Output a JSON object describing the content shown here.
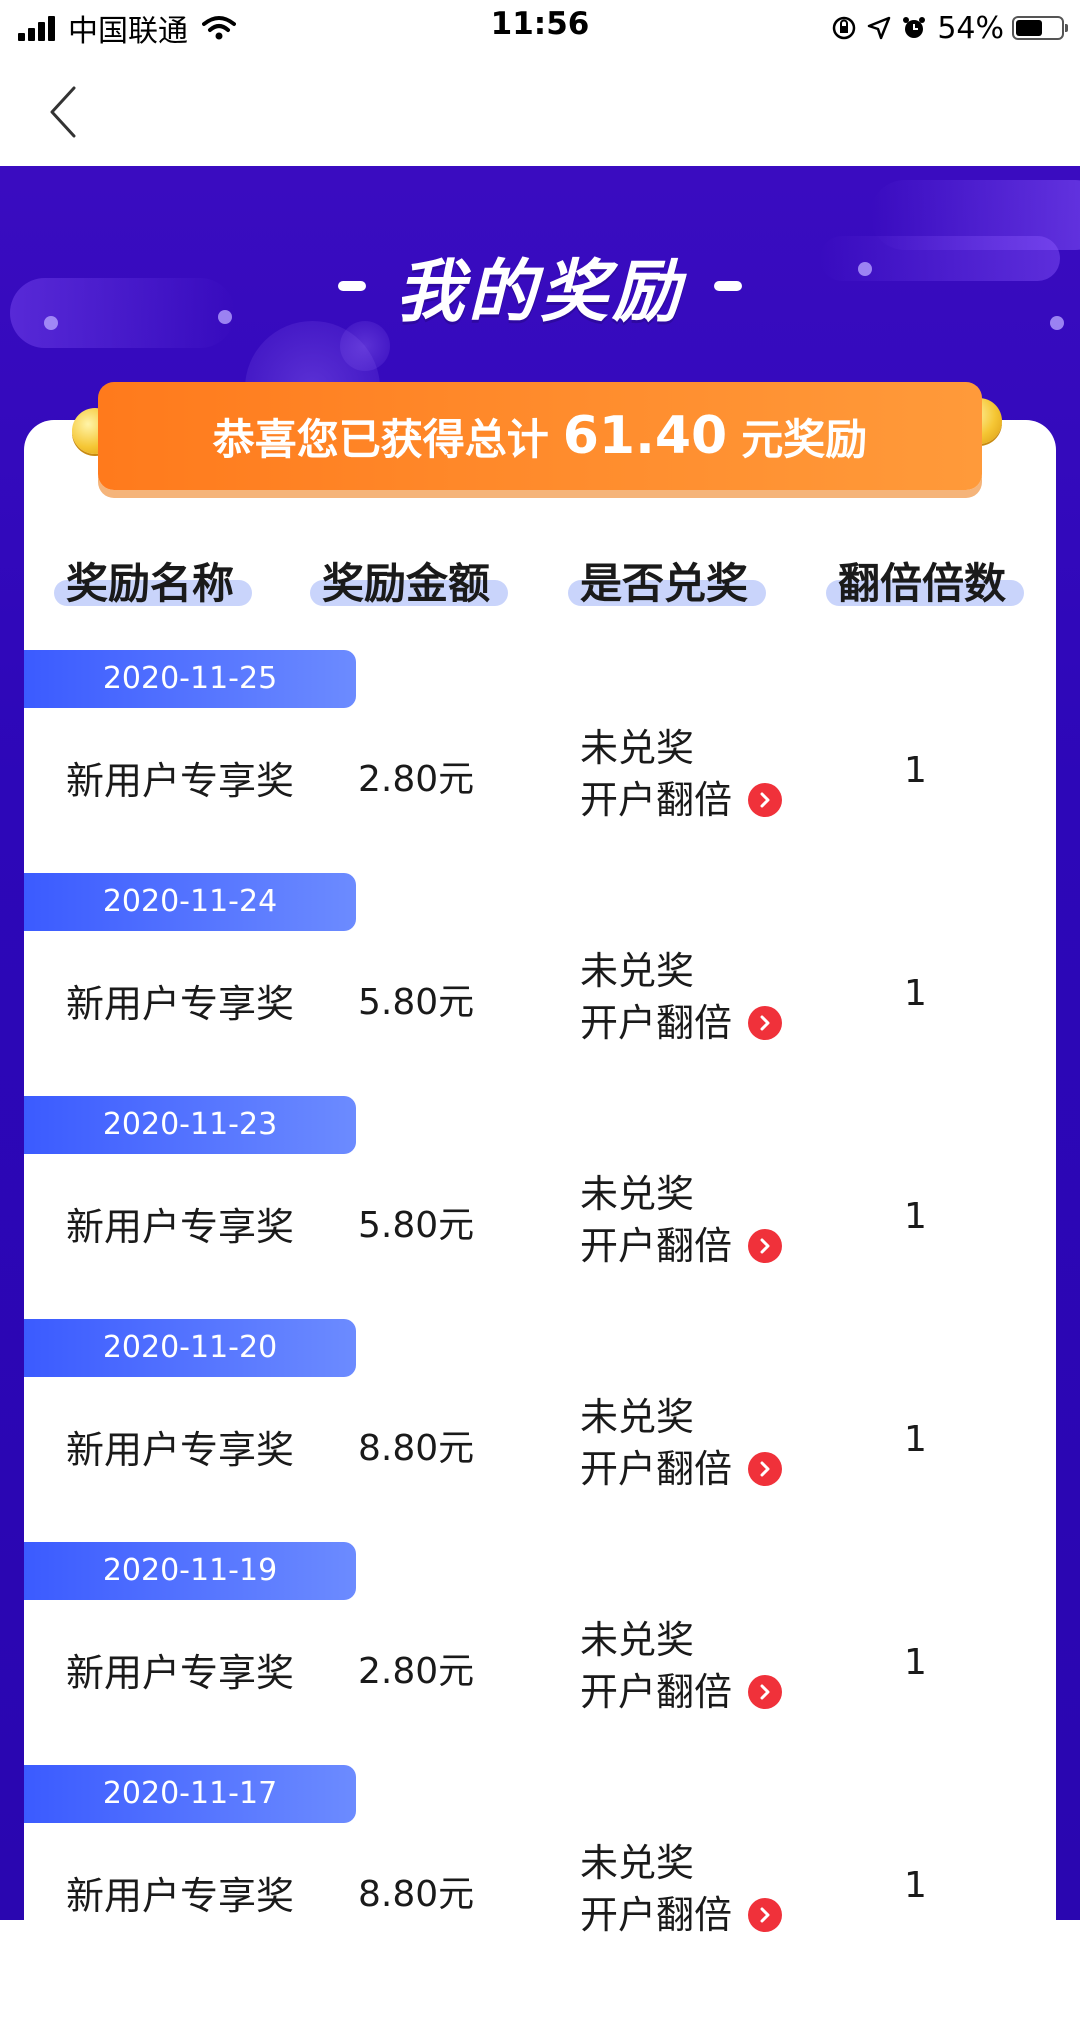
{
  "status_bar": {
    "carrier": "中国联通",
    "time": "11:56",
    "battery": "54%"
  },
  "page": {
    "title": "我的奖励",
    "banner": {
      "prefix": "恭喜您已获得总计",
      "amount": "61.40",
      "suffix": "元奖励"
    },
    "columns": [
      "奖励名称",
      "奖励金额",
      "是否兑奖",
      "翻倍倍数"
    ]
  },
  "records": [
    {
      "date": "2020-11-25",
      "name": "新用户专享奖",
      "amount": "2.80元",
      "status": "未兑奖",
      "action": "开户翻倍",
      "multiplier": "1"
    },
    {
      "date": "2020-11-24",
      "name": "新用户专享奖",
      "amount": "5.80元",
      "status": "未兑奖",
      "action": "开户翻倍",
      "multiplier": "1"
    },
    {
      "date": "2020-11-23",
      "name": "新用户专享奖",
      "amount": "5.80元",
      "status": "未兑奖",
      "action": "开户翻倍",
      "multiplier": "1"
    },
    {
      "date": "2020-11-20",
      "name": "新用户专享奖",
      "amount": "8.80元",
      "status": "未兑奖",
      "action": "开户翻倍",
      "multiplier": "1"
    },
    {
      "date": "2020-11-19",
      "name": "新用户专享奖",
      "amount": "2.80元",
      "status": "未兑奖",
      "action": "开户翻倍",
      "multiplier": "1"
    },
    {
      "date": "2020-11-17",
      "name": "新用户专享奖",
      "amount": "8.80元",
      "status": "未兑奖",
      "action": "开户翻倍",
      "multiplier": "1"
    }
  ],
  "colors": {
    "hero_bg": "#2d07b8",
    "banner": "#ff8b2c",
    "date_tag": "#3b5bff",
    "arrow_badge": "#f0313a"
  }
}
